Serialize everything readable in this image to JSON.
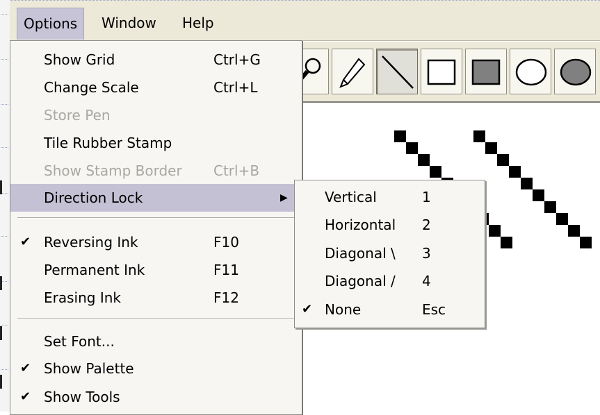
{
  "menubar": {
    "items": [
      "Options",
      "Window",
      "Help"
    ],
    "active": "Options"
  },
  "options_menu": {
    "group1": [
      {
        "label": "Show Grid",
        "shortcut": "Ctrl+G",
        "enabled": true
      },
      {
        "label": "Change Scale",
        "shortcut": "Ctrl+L",
        "enabled": true
      },
      {
        "label": "Store Pen",
        "shortcut": "",
        "enabled": false
      },
      {
        "label": "Tile Rubber Stamp",
        "shortcut": "",
        "enabled": true
      },
      {
        "label": "Show Stamp Border",
        "shortcut": "Ctrl+B",
        "enabled": false
      },
      {
        "label": "Direction Lock",
        "shortcut": "",
        "enabled": true,
        "submenu": true,
        "highlighted": true
      }
    ],
    "group2": [
      {
        "label": "Reversing Ink",
        "shortcut": "F10",
        "checked": true
      },
      {
        "label": "Permanent Ink",
        "shortcut": "F11",
        "checked": false
      },
      {
        "label": "Erasing Ink",
        "shortcut": "F12",
        "checked": false
      }
    ],
    "group3": [
      {
        "label": "Set Font...",
        "checked": false
      },
      {
        "label": "Show Palette",
        "checked": true
      },
      {
        "label": "Show Tools",
        "checked": true
      }
    ],
    "check_glyph": "✔",
    "arrow_glyph": "▶"
  },
  "direction_lock_submenu": [
    {
      "label": "Vertical",
      "shortcut": "1",
      "checked": false
    },
    {
      "label": "Horizontal",
      "shortcut": "2",
      "checked": false
    },
    {
      "label": "Diagonal \\",
      "shortcut": "3",
      "checked": false
    },
    {
      "label": "Diagonal /",
      "shortcut": "4",
      "checked": false
    },
    {
      "label": "None",
      "shortcut": "Esc",
      "checked": true
    }
  ],
  "toolbar": {
    "tools": [
      "magnifier-icon",
      "pencil-icon",
      "line-icon",
      "rectangle-icon",
      "filled-rectangle-icon",
      "ellipse-icon",
      "filled-ellipse-icon"
    ],
    "pressed": "line-icon"
  },
  "colors": {
    "menubar_bg": "#ece9d8",
    "menu_bg": "#f7f6f3",
    "highlight": "#c5c1d4",
    "disabled_text": "#a8a7a2"
  }
}
